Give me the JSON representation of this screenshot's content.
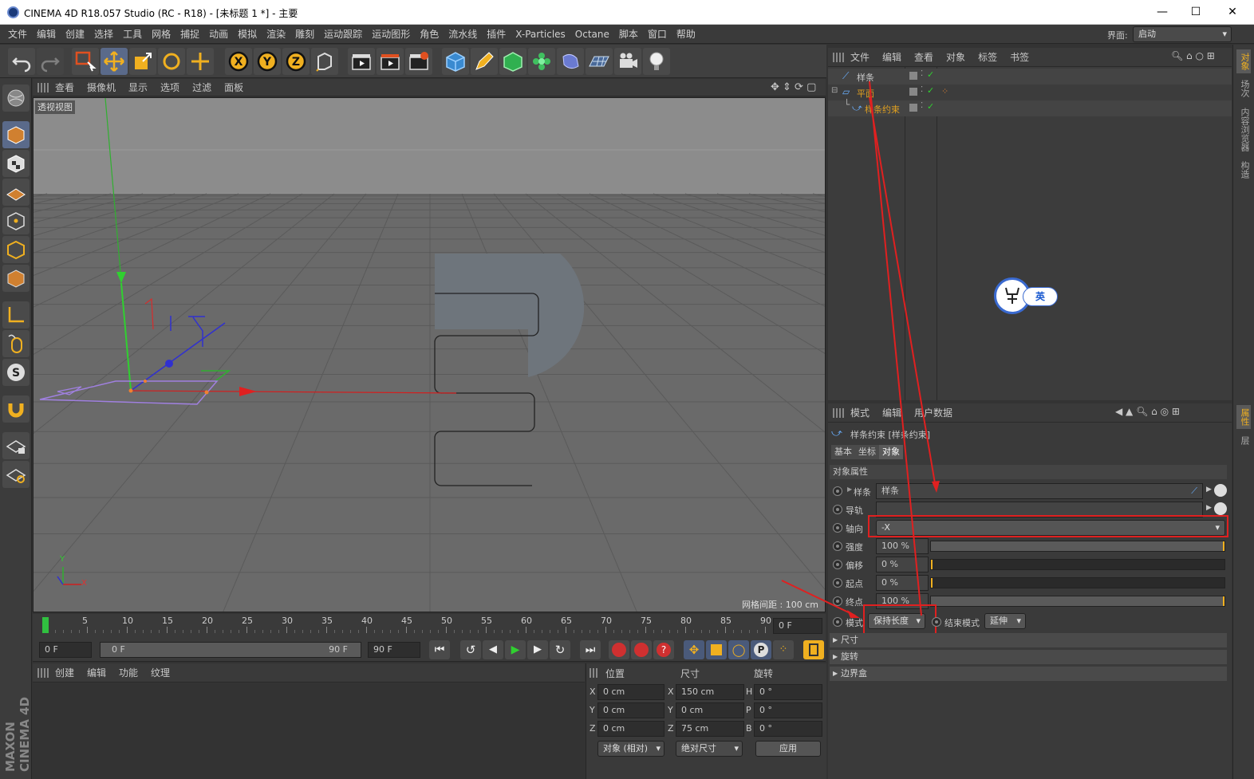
{
  "window": {
    "title": "CINEMA 4D R18.057 Studio (RC - R18) - [未标题 1 *] - 主要"
  },
  "menu": [
    "文件",
    "编辑",
    "创建",
    "选择",
    "工具",
    "网格",
    "捕捉",
    "动画",
    "模拟",
    "渲染",
    "雕刻",
    "运动跟踪",
    "运动图形",
    "角色",
    "流水线",
    "插件",
    "X-Particles",
    "Octane",
    "脚本",
    "窗口",
    "帮助"
  ],
  "layout": {
    "label": "界面:",
    "value": "启动"
  },
  "viewport": {
    "menu": [
      "查看",
      "摄像机",
      "显示",
      "选项",
      "过滤",
      "面板"
    ],
    "name": "透视视图",
    "grid_info": "网格间距 : 100 cm",
    "axis_y": "Y",
    "axis_x": "X"
  },
  "timeline": {
    "ticks": [
      "0",
      "5",
      "10",
      "15",
      "20",
      "25",
      "30",
      "35",
      "40",
      "45",
      "50",
      "55",
      "60",
      "65",
      "70",
      "75",
      "80",
      "85",
      "90"
    ],
    "current_frame": "0 F",
    "start": "0 F",
    "range_start": "0 F",
    "range_end": "90 F",
    "end": "90 F"
  },
  "material": {
    "menu": [
      "创建",
      "编辑",
      "功能",
      "纹理"
    ]
  },
  "coords": {
    "headers": [
      "位置",
      "尺寸",
      "旋转"
    ],
    "rows": [
      {
        "axis": "X",
        "pos": "0 cm",
        "size_axis": "X",
        "size": "150 cm",
        "rot_axis": "H",
        "rot": "0 °"
      },
      {
        "axis": "Y",
        "pos": "0 cm",
        "size_axis": "Y",
        "size": "0 cm",
        "rot_axis": "P",
        "rot": "0 °"
      },
      {
        "axis": "Z",
        "pos": "0 cm",
        "size_axis": "Z",
        "size": "75 cm",
        "rot_axis": "B",
        "rot": "0 °"
      }
    ],
    "mode1": "对象 (相对)",
    "mode2": "绝对尺寸",
    "apply": "应用"
  },
  "objects": {
    "menu": [
      "文件",
      "编辑",
      "查看",
      "对象",
      "标签",
      "书签"
    ],
    "items": [
      {
        "name": "样条",
        "color": "#c8c8c8"
      },
      {
        "name": "平面",
        "color": "#e0a020"
      },
      {
        "name": "样条约束",
        "color": "#e0a020"
      }
    ]
  },
  "ime": {
    "label": "英"
  },
  "attributes": {
    "menu": [
      "模式",
      "编辑",
      "用户数据"
    ],
    "object_title": "样条约束 [样条约束]",
    "tabs": [
      "基本",
      "坐标",
      "对象"
    ],
    "section": "对象属性",
    "spline_label": "样条",
    "spline_value": "样条",
    "rail_label": "导轨",
    "axis_label": "轴向",
    "axis_value": "-X",
    "strength_label": "强度",
    "strength_value": "100 %",
    "strength_fill": 1.0,
    "offset_label": "偏移",
    "offset_value": "0 %",
    "offset_fill": 0.0,
    "start_label": "起点",
    "start_value": "0 %",
    "start_fill": 0.0,
    "end_label": "终点",
    "end_value": "100 %",
    "end_fill": 1.0,
    "mode_label": "模式",
    "mode_value": "保持长度",
    "endmode_label": "结束模式",
    "endmode_value": "延伸",
    "groups": [
      "尺寸",
      "旋转",
      "边界盒"
    ]
  },
  "right_tabs": [
    "对象",
    "场次",
    "内容浏览器",
    "构造",
    "属性",
    "层"
  ],
  "brand": "MAXON CINEMA 4D"
}
